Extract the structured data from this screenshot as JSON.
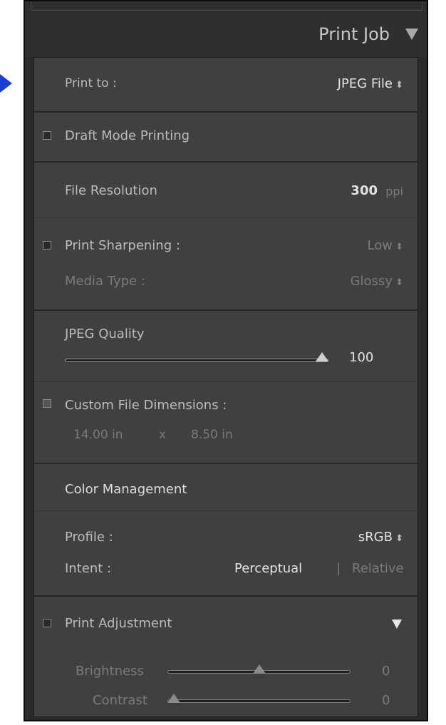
{
  "panel": {
    "title": "Print Job",
    "title_icon": "triangle-down-icon"
  },
  "print_to": {
    "label": "Print to :",
    "value": "JPEG File"
  },
  "draft_mode": {
    "label": "Draft Mode Printing",
    "checked": false
  },
  "file_resolution": {
    "label": "File Resolution",
    "value": "300",
    "unit": "ppi"
  },
  "sharpening": {
    "label": "Print Sharpening :",
    "checked": false,
    "level": "Low",
    "media_label": "Media Type :",
    "media_value": "Glossy"
  },
  "jpeg_quality": {
    "label": "JPEG Quality",
    "value": "100",
    "fraction": 1.0
  },
  "custom_dims": {
    "label": "Custom File Dimensions :",
    "checked": false,
    "width": "14.00 in",
    "separator": "x",
    "height": "8.50 in"
  },
  "color_management": {
    "heading": "Color Management",
    "profile_label": "Profile :",
    "profile_value": "sRGB",
    "intent_label": "Intent :",
    "intent_selected": "Perceptual",
    "intent_separator": "|",
    "intent_other": "Relative"
  },
  "print_adjustment": {
    "label": "Print Adjustment",
    "checked": false,
    "toggle_icon": "triangle-down-icon",
    "brightness_label": "Brightness",
    "brightness_value": "0",
    "brightness_fraction": 0.5,
    "contrast_label": "Contrast",
    "contrast_value": "0",
    "contrast_fraction": 0.0
  },
  "colors": {
    "pointer_arrow": "#1c3ed6",
    "panel_bg": "#404040",
    "header_bg": "#2f2f2f"
  }
}
